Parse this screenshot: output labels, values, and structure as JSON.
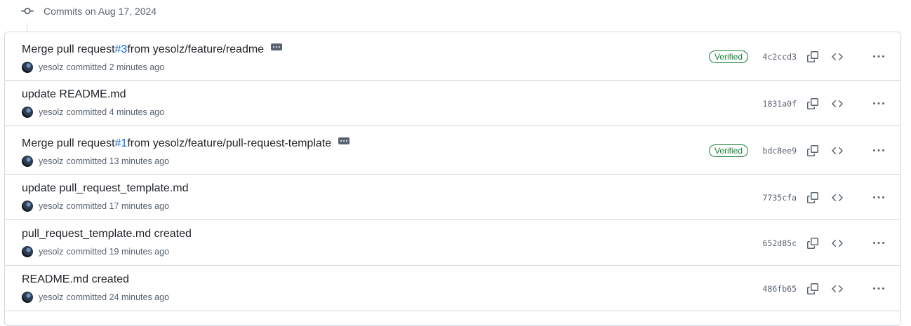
{
  "group": {
    "label": "Commits on Aug 17, 2024"
  },
  "commits": [
    {
      "title_before": "Merge pull request ",
      "pr": "#3",
      "title_after": " from yesolz/feature/readme",
      "has_ellipsis": true,
      "author": "yesolz",
      "time": "committed 2 minutes ago",
      "verified": "Verified",
      "sha": "4c2ccd3"
    },
    {
      "title_before": "update README.md",
      "pr": "",
      "title_after": "",
      "has_ellipsis": false,
      "author": "yesolz",
      "time": "committed 4 minutes ago",
      "verified": "",
      "sha": "1831a0f"
    },
    {
      "title_before": "Merge pull request ",
      "pr": "#1",
      "title_after": " from yesolz/feature/pull-request-template",
      "has_ellipsis": true,
      "author": "yesolz",
      "time": "committed 13 minutes ago",
      "verified": "Verified",
      "sha": "bdc8ee9"
    },
    {
      "title_before": "update pull_request_template.md",
      "pr": "",
      "title_after": "",
      "has_ellipsis": false,
      "author": "yesolz",
      "time": "committed 17 minutes ago",
      "verified": "",
      "sha": "7735cfa"
    },
    {
      "title_before": "pull_request_template.md created",
      "pr": "",
      "title_after": "",
      "has_ellipsis": false,
      "author": "yesolz",
      "time": "committed 19 minutes ago",
      "verified": "",
      "sha": "652d85c"
    },
    {
      "title_before": "README.md created",
      "pr": "",
      "title_after": "",
      "has_ellipsis": false,
      "author": "yesolz",
      "time": "committed 24 minutes ago",
      "verified": "",
      "sha": "486fb65"
    }
  ],
  "colors": {
    "link": "#0969da",
    "verified": "#1a7f37",
    "muted": "#59636e",
    "border": "#d1d9e0"
  }
}
